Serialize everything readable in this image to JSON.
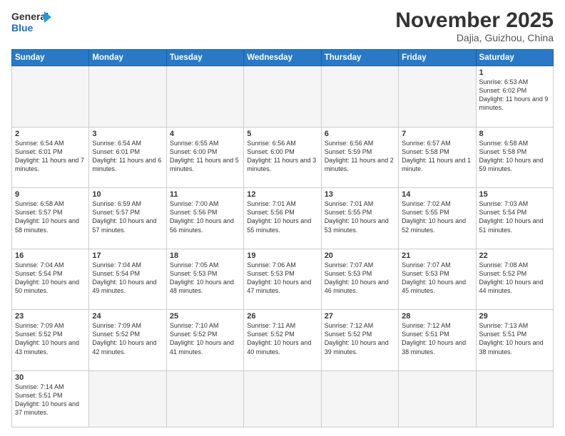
{
  "logo": {
    "text_general": "General",
    "text_blue": "Blue"
  },
  "header": {
    "month": "November 2025",
    "location": "Dajia, Guizhou, China"
  },
  "weekdays": [
    "Sunday",
    "Monday",
    "Tuesday",
    "Wednesday",
    "Thursday",
    "Friday",
    "Saturday"
  ],
  "weeks": [
    [
      {
        "day": "",
        "info": ""
      },
      {
        "day": "",
        "info": ""
      },
      {
        "day": "",
        "info": ""
      },
      {
        "day": "",
        "info": ""
      },
      {
        "day": "",
        "info": ""
      },
      {
        "day": "",
        "info": ""
      },
      {
        "day": "1",
        "info": "Sunrise: 6:53 AM\nSunset: 6:02 PM\nDaylight: 11 hours and 9 minutes."
      }
    ],
    [
      {
        "day": "2",
        "info": "Sunrise: 6:54 AM\nSunset: 6:01 PM\nDaylight: 11 hours and 7 minutes."
      },
      {
        "day": "3",
        "info": "Sunrise: 6:54 AM\nSunset: 6:01 PM\nDaylight: 11 hours and 6 minutes."
      },
      {
        "day": "4",
        "info": "Sunrise: 6:55 AM\nSunset: 6:00 PM\nDaylight: 11 hours and 5 minutes."
      },
      {
        "day": "5",
        "info": "Sunrise: 6:56 AM\nSunset: 6:00 PM\nDaylight: 11 hours and 3 minutes."
      },
      {
        "day": "6",
        "info": "Sunrise: 6:56 AM\nSunset: 5:59 PM\nDaylight: 11 hours and 2 minutes."
      },
      {
        "day": "7",
        "info": "Sunrise: 6:57 AM\nSunset: 5:58 PM\nDaylight: 11 hours and 1 minute."
      },
      {
        "day": "8",
        "info": "Sunrise: 6:58 AM\nSunset: 5:58 PM\nDaylight: 10 hours and 59 minutes."
      }
    ],
    [
      {
        "day": "9",
        "info": "Sunrise: 6:58 AM\nSunset: 5:57 PM\nDaylight: 10 hours and 58 minutes."
      },
      {
        "day": "10",
        "info": "Sunrise: 6:59 AM\nSunset: 5:57 PM\nDaylight: 10 hours and 57 minutes."
      },
      {
        "day": "11",
        "info": "Sunrise: 7:00 AM\nSunset: 5:56 PM\nDaylight: 10 hours and 56 minutes."
      },
      {
        "day": "12",
        "info": "Sunrise: 7:01 AM\nSunset: 5:56 PM\nDaylight: 10 hours and 55 minutes."
      },
      {
        "day": "13",
        "info": "Sunrise: 7:01 AM\nSunset: 5:55 PM\nDaylight: 10 hours and 53 minutes."
      },
      {
        "day": "14",
        "info": "Sunrise: 7:02 AM\nSunset: 5:55 PM\nDaylight: 10 hours and 52 minutes."
      },
      {
        "day": "15",
        "info": "Sunrise: 7:03 AM\nSunset: 5:54 PM\nDaylight: 10 hours and 51 minutes."
      }
    ],
    [
      {
        "day": "16",
        "info": "Sunrise: 7:04 AM\nSunset: 5:54 PM\nDaylight: 10 hours and 50 minutes."
      },
      {
        "day": "17",
        "info": "Sunrise: 7:04 AM\nSunset: 5:54 PM\nDaylight: 10 hours and 49 minutes."
      },
      {
        "day": "18",
        "info": "Sunrise: 7:05 AM\nSunset: 5:53 PM\nDaylight: 10 hours and 48 minutes."
      },
      {
        "day": "19",
        "info": "Sunrise: 7:06 AM\nSunset: 5:53 PM\nDaylight: 10 hours and 47 minutes."
      },
      {
        "day": "20",
        "info": "Sunrise: 7:07 AM\nSunset: 5:53 PM\nDaylight: 10 hours and 46 minutes."
      },
      {
        "day": "21",
        "info": "Sunrise: 7:07 AM\nSunset: 5:53 PM\nDaylight: 10 hours and 45 minutes."
      },
      {
        "day": "22",
        "info": "Sunrise: 7:08 AM\nSunset: 5:52 PM\nDaylight: 10 hours and 44 minutes."
      }
    ],
    [
      {
        "day": "23",
        "info": "Sunrise: 7:09 AM\nSunset: 5:52 PM\nDaylight: 10 hours and 43 minutes."
      },
      {
        "day": "24",
        "info": "Sunrise: 7:09 AM\nSunset: 5:52 PM\nDaylight: 10 hours and 42 minutes."
      },
      {
        "day": "25",
        "info": "Sunrise: 7:10 AM\nSunset: 5:52 PM\nDaylight: 10 hours and 41 minutes."
      },
      {
        "day": "26",
        "info": "Sunrise: 7:11 AM\nSunset: 5:52 PM\nDaylight: 10 hours and 40 minutes."
      },
      {
        "day": "27",
        "info": "Sunrise: 7:12 AM\nSunset: 5:52 PM\nDaylight: 10 hours and 39 minutes."
      },
      {
        "day": "28",
        "info": "Sunrise: 7:12 AM\nSunset: 5:51 PM\nDaylight: 10 hours and 38 minutes."
      },
      {
        "day": "29",
        "info": "Sunrise: 7:13 AM\nSunset: 5:51 PM\nDaylight: 10 hours and 38 minutes."
      }
    ],
    [
      {
        "day": "30",
        "info": "Sunrise: 7:14 AM\nSunset: 5:51 PM\nDaylight: 10 hours and 37 minutes."
      },
      {
        "day": "",
        "info": ""
      },
      {
        "day": "",
        "info": ""
      },
      {
        "day": "",
        "info": ""
      },
      {
        "day": "",
        "info": ""
      },
      {
        "day": "",
        "info": ""
      },
      {
        "day": "",
        "info": ""
      }
    ]
  ]
}
